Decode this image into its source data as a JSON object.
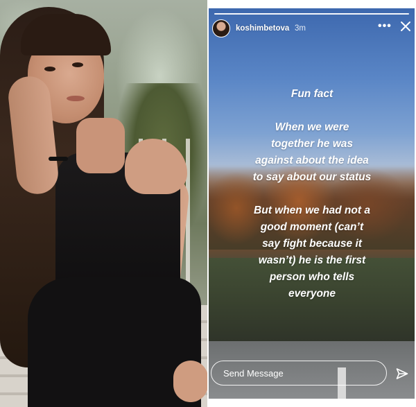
{
  "story": {
    "username": "koshimbetova",
    "time": "3m",
    "more_icon": "more-horizontal-icon",
    "close_icon": "close-icon",
    "text_lines": [
      "Fun fact",
      "",
      "When we were",
      "together he was",
      "against about the idea",
      "to say about our  status",
      "",
      "But when we had not a",
      "good moment (can’t",
      "say fight because it",
      "wasn’t) he is the first",
      "person who tells",
      "everyone"
    ],
    "reply_placeholder": "Send Message",
    "send_icon": "paper-plane-icon"
  },
  "colors": {
    "text": "#ffffff",
    "sky_top": "#3d68ae",
    "ground": "#343a2f"
  }
}
